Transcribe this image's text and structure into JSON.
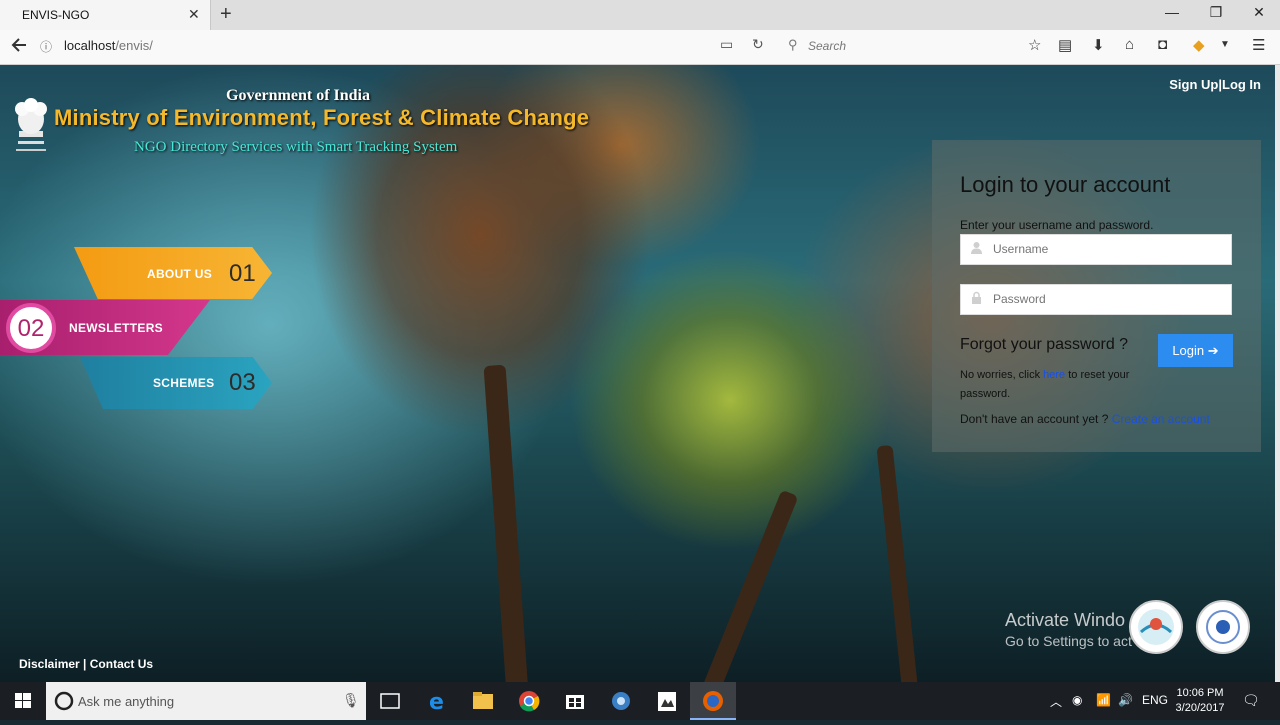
{
  "browser": {
    "tab_title": "ENVIS-NGO",
    "url_host": "localhost",
    "url_path": "/envis/",
    "search_placeholder": "Search"
  },
  "header": {
    "gov": "Government of India",
    "ministry": "Ministry of Environment, Forest & Climate Change",
    "subtitle": "NGO Directory Services with Smart Tracking System",
    "signup": "Sign Up",
    "separator": "|",
    "login": "Log In"
  },
  "menu": {
    "about": {
      "label": "ABOUT US",
      "num": "01"
    },
    "newsletters": {
      "label": "NEWSLETTERS",
      "num": "02"
    },
    "schemes": {
      "label": "SCHEMES",
      "num": "03"
    }
  },
  "login_panel": {
    "title": "Login to your account",
    "hint": "Enter your username and password.",
    "username_placeholder": "Username",
    "password_placeholder": "Password",
    "forgot": "Forgot your password ?",
    "button": "Login",
    "worries_prefix": "No worries, click",
    "worries_link": "here",
    "worries_suffix": "to reset your password.",
    "no_account": "Don't have an account yet ?",
    "create_link": "Create an account"
  },
  "watermark": {
    "line1": "Activate Windo",
    "line2": "Go to Settings to act"
  },
  "footer": {
    "disclaimer": "Disclaimer",
    "sep": "|",
    "contact": "Contact Us"
  },
  "taskbar": {
    "search_text": "Ask me anything",
    "lang": "ENG",
    "time": "10:06 PM",
    "date": "3/20/2017"
  },
  "colors": {
    "accent_orange": "#f4b82a",
    "accent_cyan": "#48e8d8",
    "login_button": "#2d8cf0",
    "newsletters": "#c02a7c",
    "schemes": "#2a94b4",
    "about": "#f5a623"
  }
}
